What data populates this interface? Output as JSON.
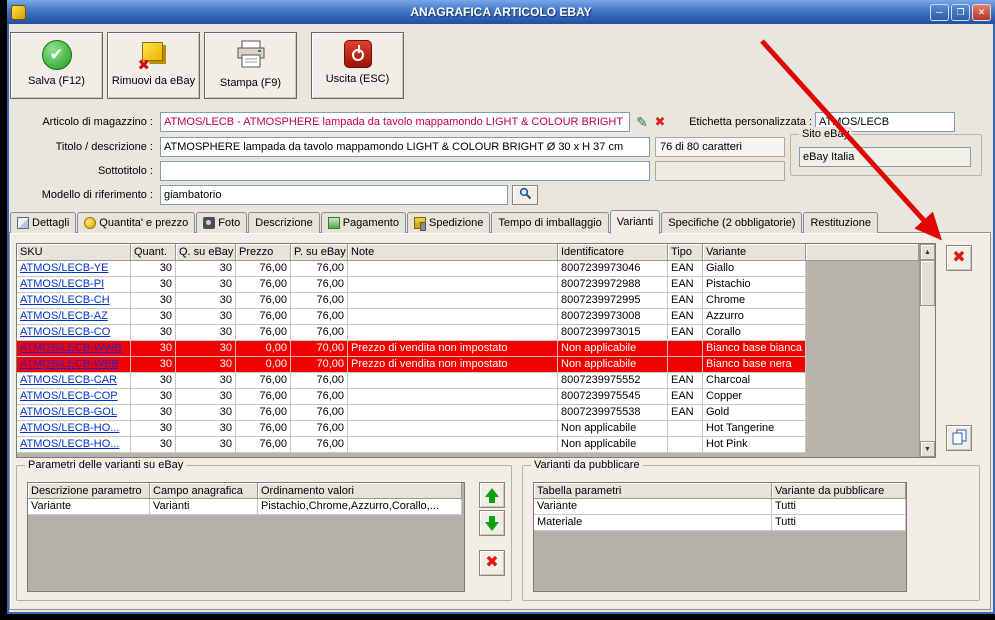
{
  "window": {
    "title": "ANAGRAFICA ARTICOLO EBAY"
  },
  "icons": {
    "edit": "✎",
    "clear": "✖",
    "save_check": "✔",
    "remove_x": "✖",
    "delete_x": "✖",
    "scroll_up": "▲",
    "scroll_down": "▼",
    "minimize": "─",
    "maximize": "❐",
    "close": "✕"
  },
  "toolbar": {
    "save_label": "Salva (F12)",
    "remove_label": "Rimuovi da eBay",
    "print_label": "Stampa (F9)",
    "exit_label": "Uscita (ESC)"
  },
  "form": {
    "warehouse": {
      "label": "Articolo di magazzino :",
      "value": "ATMOS/LECB - ATMOSPHERE lampada da tavolo mappamondo LIGHT & COLOUR BRIGHT"
    },
    "custom_label": {
      "label": "Etichetta personalizzata :",
      "value": "ATMOS/LECB"
    },
    "title": {
      "label": "Titolo / descrizione :",
      "value": "ATMOSPHERE lampada da tavolo mappamondo LIGHT & COLOUR BRIGHT Ø 30 x H 37 cm",
      "counter": "76 di 80 caratteri"
    },
    "subtitle": {
      "label": "Sottotitolo :",
      "value": ""
    },
    "model": {
      "label": "Modello di riferimento :",
      "value": "giambatorio"
    },
    "ebay_site": {
      "label": "Sito eBay",
      "value": "eBay Italia"
    }
  },
  "tabs": [
    {
      "label": "Dettagli",
      "icon": "details"
    },
    {
      "label": "Quantita' e prezzo",
      "icon": "coins"
    },
    {
      "label": "Foto",
      "icon": "camera"
    },
    {
      "label": "Descrizione"
    },
    {
      "label": "Pagamento",
      "icon": "money"
    },
    {
      "label": "Spedizione",
      "icon": "truck"
    },
    {
      "label": "Tempo di imballaggio"
    },
    {
      "label": "Varianti",
      "active": true
    },
    {
      "label": "Specifiche (2 obbligatorie)"
    },
    {
      "label": "Restituzione"
    }
  ],
  "variants": {
    "columns": [
      "SKU",
      "Quant.",
      "Q. su eBay",
      "Prezzo",
      "P. su eBay",
      "Note",
      "Identificatore",
      "Tipo",
      "Variante"
    ],
    "rows": [
      {
        "sku": "ATMOS/LECB-YE",
        "quant": "30",
        "q_ebay": "30",
        "prezzo": "76,00",
        "p_ebay": "76,00",
        "note": "",
        "identificatore": "8007239973046",
        "tipo": "EAN",
        "variante": "Giallo",
        "error": false
      },
      {
        "sku": "ATMOS/LECB-PI",
        "quant": "30",
        "q_ebay": "30",
        "prezzo": "76,00",
        "p_ebay": "76,00",
        "note": "",
        "identificatore": "8007239972988",
        "tipo": "EAN",
        "variante": "Pistachio",
        "error": false
      },
      {
        "sku": "ATMOS/LECB-CH",
        "quant": "30",
        "q_ebay": "30",
        "prezzo": "76,00",
        "p_ebay": "76,00",
        "note": "",
        "identificatore": "8007239972995",
        "tipo": "EAN",
        "variante": "Chrome",
        "error": false
      },
      {
        "sku": "ATMOS/LECB-AZ",
        "quant": "30",
        "q_ebay": "30",
        "prezzo": "76,00",
        "p_ebay": "76,00",
        "note": "",
        "identificatore": "8007239973008",
        "tipo": "EAN",
        "variante": "Azzurro",
        "error": false
      },
      {
        "sku": "ATMOS/LECB-CO",
        "quant": "30",
        "q_ebay": "30",
        "prezzo": "76,00",
        "p_ebay": "76,00",
        "note": "",
        "identificatore": "8007239973015",
        "tipo": "EAN",
        "variante": "Corallo",
        "error": false
      },
      {
        "sku": "ATMOS/LECB-WWB",
        "quant": "30",
        "q_ebay": "30",
        "prezzo": "0,00",
        "p_ebay": "70,00",
        "note": "Prezzo di vendita non impostato",
        "identificatore": "Non applicabile",
        "tipo": "",
        "variante": "Bianco base bianca",
        "error": true
      },
      {
        "sku": "ATMOS/LECB-WBB",
        "quant": "30",
        "q_ebay": "30",
        "prezzo": "0,00",
        "p_ebay": "70,00",
        "note": "Prezzo di vendita non impostato",
        "identificatore": "Non applicabile",
        "tipo": "",
        "variante": "Bianco base nera",
        "error": true
      },
      {
        "sku": "ATMOS/LECB-CAR",
        "quant": "30",
        "q_ebay": "30",
        "prezzo": "76,00",
        "p_ebay": "76,00",
        "note": "",
        "identificatore": "8007239975552",
        "tipo": "EAN",
        "variante": "Charcoal",
        "error": false
      },
      {
        "sku": "ATMOS/LECB-COP",
        "quant": "30",
        "q_ebay": "30",
        "prezzo": "76,00",
        "p_ebay": "76,00",
        "note": "",
        "identificatore": "8007239975545",
        "tipo": "EAN",
        "variante": "Copper",
        "error": false
      },
      {
        "sku": "ATMOS/LECB-GOL",
        "quant": "30",
        "q_ebay": "30",
        "prezzo": "76,00",
        "p_ebay": "76,00",
        "note": "",
        "identificatore": "8007239975538",
        "tipo": "EAN",
        "variante": "Gold",
        "error": false
      },
      {
        "sku": "ATMOS/LECB-HO...",
        "quant": "30",
        "q_ebay": "30",
        "prezzo": "76,00",
        "p_ebay": "76,00",
        "note": "",
        "identificatore": "Non applicabile",
        "tipo": "",
        "variante": "Hot Tangerine",
        "error": false
      },
      {
        "sku": "ATMOS/LECB-HO...",
        "quant": "30",
        "q_ebay": "30",
        "prezzo": "76,00",
        "p_ebay": "76,00",
        "note": "",
        "identificatore": "Non applicabile",
        "tipo": "",
        "variante": "Hot Pink",
        "error": false
      }
    ]
  },
  "params_panel": {
    "title": "Parametri delle varianti su eBay",
    "columns": [
      "Descrizione parametro",
      "Campo anagrafica",
      "Ordinamento valori"
    ],
    "rows": [
      [
        "Variante",
        "Varianti",
        "Pistachio,Chrome,Azzurro,Corallo,..."
      ]
    ]
  },
  "publish_panel": {
    "title": "Varianti da pubblicare",
    "columns": [
      "Tabella parametri",
      "Variante da pubblicare"
    ],
    "rows": [
      [
        "Variante",
        "Tutti"
      ],
      [
        "Materiale",
        "Tutti"
      ]
    ]
  }
}
